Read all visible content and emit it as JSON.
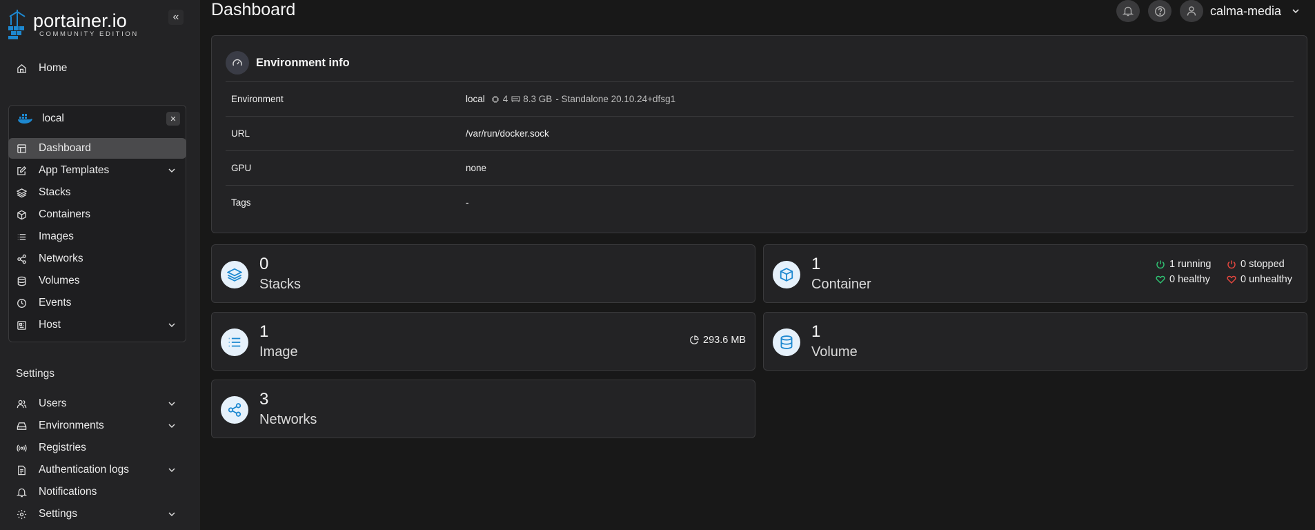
{
  "sidebar": {
    "logo_title": "portainer.io",
    "logo_subtitle": "COMMUNITY EDITION",
    "home_label": "Home",
    "environment": {
      "name": "local",
      "items": [
        {
          "label": "Dashboard",
          "icon": "dashboard-icon",
          "active": true
        },
        {
          "label": "App Templates",
          "icon": "edit-icon",
          "expandable": true
        },
        {
          "label": "Stacks",
          "icon": "layers-icon"
        },
        {
          "label": "Containers",
          "icon": "box-icon"
        },
        {
          "label": "Images",
          "icon": "list-icon"
        },
        {
          "label": "Networks",
          "icon": "share-icon"
        },
        {
          "label": "Volumes",
          "icon": "database-icon"
        },
        {
          "label": "Events",
          "icon": "clock-icon"
        },
        {
          "label": "Host",
          "icon": "host-icon",
          "expandable": true
        }
      ]
    },
    "settings_label": "Settings",
    "settings_items": [
      {
        "label": "Users",
        "icon": "users-icon",
        "expandable": true
      },
      {
        "label": "Environments",
        "icon": "hdd-icon",
        "expandable": true
      },
      {
        "label": "Registries",
        "icon": "radio-icon"
      },
      {
        "label": "Authentication logs",
        "icon": "file-icon",
        "expandable": true
      },
      {
        "label": "Notifications",
        "icon": "bell-icon"
      },
      {
        "label": "Settings",
        "icon": "gear-icon",
        "expandable": true
      }
    ]
  },
  "header": {
    "title": "Dashboard",
    "username": "calma-media"
  },
  "env_info": {
    "title": "Environment info",
    "rows": {
      "environment": {
        "key": "Environment",
        "name": "local",
        "cpu": "4",
        "memory": "8.3 GB",
        "detail": "- Standalone 20.10.24+dfsg1"
      },
      "url": {
        "key": "URL",
        "value": "/var/run/docker.sock"
      },
      "gpu": {
        "key": "GPU",
        "value": "none"
      },
      "tags": {
        "key": "Tags",
        "value": "-"
      }
    }
  },
  "stats": {
    "stacks": {
      "count": "0",
      "label": "Stacks"
    },
    "containers": {
      "count": "1",
      "label": "Container",
      "running": "1 running",
      "stopped": "0 stopped",
      "healthy": "0 healthy",
      "unhealthy": "0 unhealthy"
    },
    "images": {
      "count": "1",
      "label": "Image",
      "size": "293.6 MB"
    },
    "volumes": {
      "count": "1",
      "label": "Volume"
    },
    "networks": {
      "count": "3",
      "label": "Networks"
    }
  },
  "colors": {
    "accent": "#1d88d0",
    "running": "#2fbf71",
    "stopped": "#e0463e"
  }
}
